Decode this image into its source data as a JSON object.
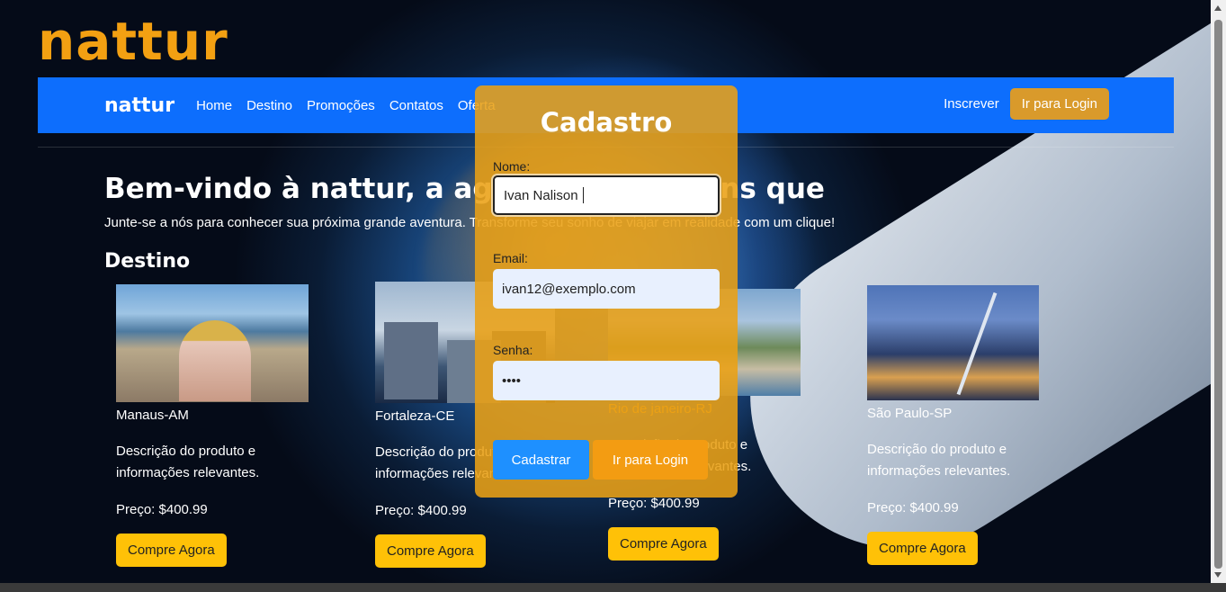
{
  "brand_logo": "nattur",
  "navbar": {
    "brand": "nattur",
    "links": [
      "Home",
      "Destino",
      "Promoções",
      "Contatos",
      "Oferta"
    ],
    "signup": "Inscrever",
    "login_button": "Ir para Login",
    "login_button_color": "#d99a2b",
    "bg_color": "#0d6efd"
  },
  "hero": {
    "title": "Bem-vindo à nattur, a agência de viagens que",
    "subtitle": "Junte-se a nós para conhecer sua próxima grande aventura. Transforme seu sonho de viajar em realidade com um clique!"
  },
  "destinations": {
    "title": "Destino",
    "items": [
      {
        "name": "Manaus-AM",
        "description": "Descrição do produto e informações relevantes.",
        "price": "Preço: $400.99",
        "button": "Compre Agora"
      },
      {
        "name": "Fortaleza-CE",
        "description": "Descrição do produto e informações relevantes.",
        "price": "Preço: $400.99",
        "button": "Compre Agora"
      },
      {
        "name": "Rio de janeiro-RJ",
        "description": "Descrição do produto e informações relevantes.",
        "price": "Preço: $400.99",
        "button": "Compre Agora"
      },
      {
        "name": "São Paulo-SP",
        "description": "Descrição do produto e informações relevantes.",
        "price": "Preço: $400.99",
        "button": "Compre Agora"
      }
    ]
  },
  "modal": {
    "title": "Cadastro",
    "name_label": "Nome:",
    "name_value": "Ivan Nalison",
    "email_label": "Email:",
    "email_value": "ivan12@exemplo.com",
    "password_label": "Senha:",
    "password_value": "••••",
    "register_button": "Cadastrar",
    "login_button": "Ir para Login",
    "register_color": "#1e90ff",
    "login_color": "#f39c12"
  }
}
